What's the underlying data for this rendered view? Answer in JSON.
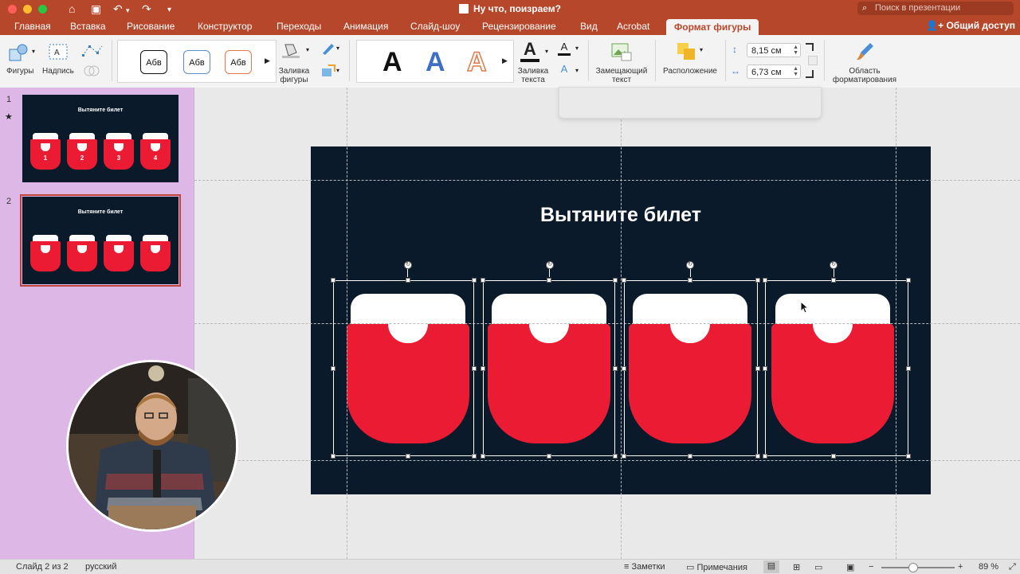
{
  "window": {
    "title": "Ну что, поизраем?",
    "search_placeholder": "Поиск в презентации"
  },
  "tabs": [
    "Главная",
    "Вставка",
    "Рисование",
    "Конструктор",
    "Переходы",
    "Анимация",
    "Слайд-шоу",
    "Рецензирование",
    "Вид",
    "Acrobat",
    "Формат фигуры"
  ],
  "active_tab": "Формат фигуры",
  "share_label": "Общий доступ",
  "ribbon": {
    "shapes_label": "Фигуры",
    "textbox_label": "Надпись",
    "style_samples": [
      "Абв",
      "Абв",
      "Абв"
    ],
    "shape_fill_label": "Заливка фигуры",
    "text_fill_label": "Заливка текста",
    "wordart_sample": "A",
    "alt_text_label": "Замещающий текст",
    "arrange_label": "Расположение",
    "height_value": "8,15 см",
    "width_value": "6,73 см",
    "format_pane_label": "Область форматирования"
  },
  "slides": [
    {
      "number": "1",
      "title": "Вытяните билет",
      "ticket_numbers": [
        "1",
        "2",
        "3",
        "4"
      ],
      "has_animation_star": true,
      "selected": false
    },
    {
      "number": "2",
      "title": "Вытяните билет",
      "ticket_numbers": [],
      "has_animation_star": false,
      "selected": true
    }
  ],
  "current_slide": {
    "title": "Вытяните билет",
    "tickets": 4
  },
  "colors": {
    "accent": "#b7472a",
    "slide_bg": "#0a1a2b",
    "ticket_red": "#ec1b34",
    "ticket_white": "#ffffff",
    "sidebar_bg": "#ddb8e6"
  },
  "status": {
    "slide_counter": "Слайд 2 из 2",
    "language": "русский",
    "notes": "Заметки",
    "comments": "Примечания",
    "zoom": "89 %"
  }
}
